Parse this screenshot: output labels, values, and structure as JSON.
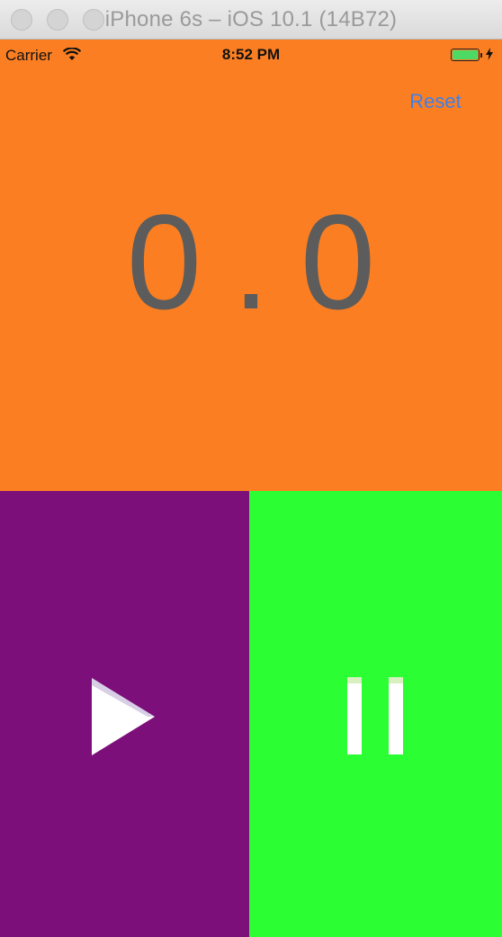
{
  "window": {
    "title": "iPhone 6s – iOS 10.1 (14B72)"
  },
  "status_bar": {
    "carrier": "Carrier",
    "time": "8:52 PM",
    "battery_level": 1.0
  },
  "stopwatch": {
    "reset_label": "Reset",
    "elapsed": "0.0"
  },
  "controls": {
    "start_icon": "play-icon",
    "stop_icon": "pause-icon"
  },
  "colors": {
    "display_background": "#fb7f22",
    "start_background": "#7c0f79",
    "stop_background": "#2bff34",
    "reset_text": "#3f7fe8",
    "counter_text": "#5c5c5c"
  }
}
